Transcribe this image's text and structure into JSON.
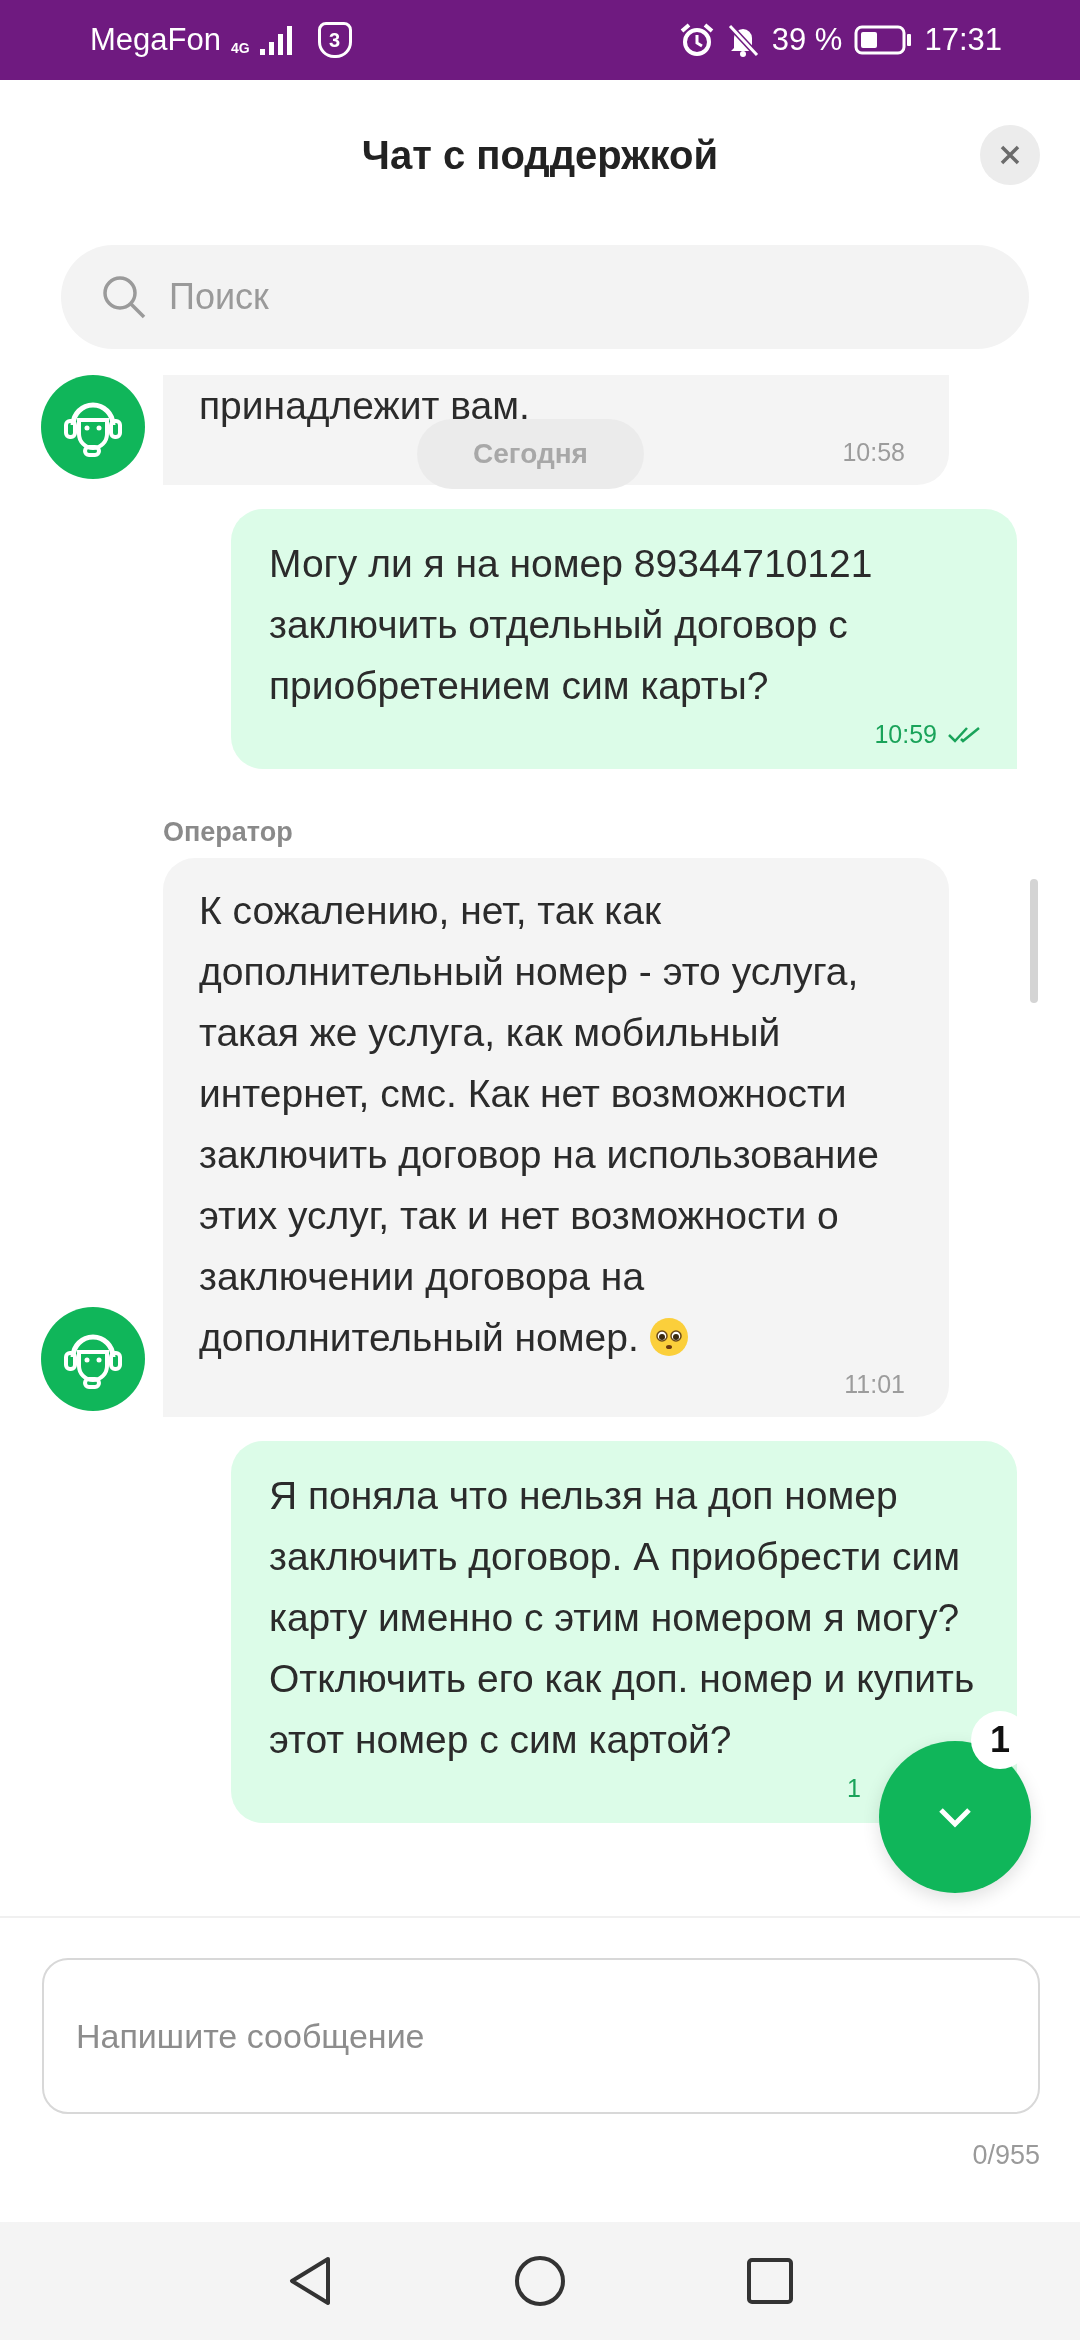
{
  "status_bar": {
    "carrier": "MegaFon",
    "network": "4G",
    "shield_count": "3",
    "battery": "39 %",
    "time": "17:31",
    "alarm": true,
    "silent": true
  },
  "header": {
    "title": "Чат с поддержкой"
  },
  "search": {
    "placeholder": "Поиск"
  },
  "date_chip": "Сегодня",
  "messages": [
    {
      "kind": "operator",
      "text": "принадлежит вам.",
      "time": "10:58",
      "avatar": true
    },
    {
      "kind": "user",
      "text": "Могу ли я на номер 89344710121 заключить отдельный договор с приобретением сим карты?",
      "time": "10:59",
      "read": true
    },
    {
      "kind": "operator",
      "sender": "Оператор",
      "text": "К сожалению, нет, так как дополнительный номер - это услуга, такая же услуга, как мобильный интернет, смс. Как нет возможности заключить договор на использование этих услуг, так и нет возможности о заключении договора на дополнительный номер.",
      "emoji": true,
      "time": "11:01",
      "avatar": true
    },
    {
      "kind": "user",
      "text": "Я поняла что нельзя на доп номер заключить договор. А приобрести сим карту именно с этим номером я могу? Отключить его как доп. номер и купить этот номер с сим картой?",
      "time": "1"
    }
  ],
  "scroll_button": {
    "badge": "1"
  },
  "composer": {
    "placeholder": "Напишите сообщение",
    "counter": "0/955"
  }
}
